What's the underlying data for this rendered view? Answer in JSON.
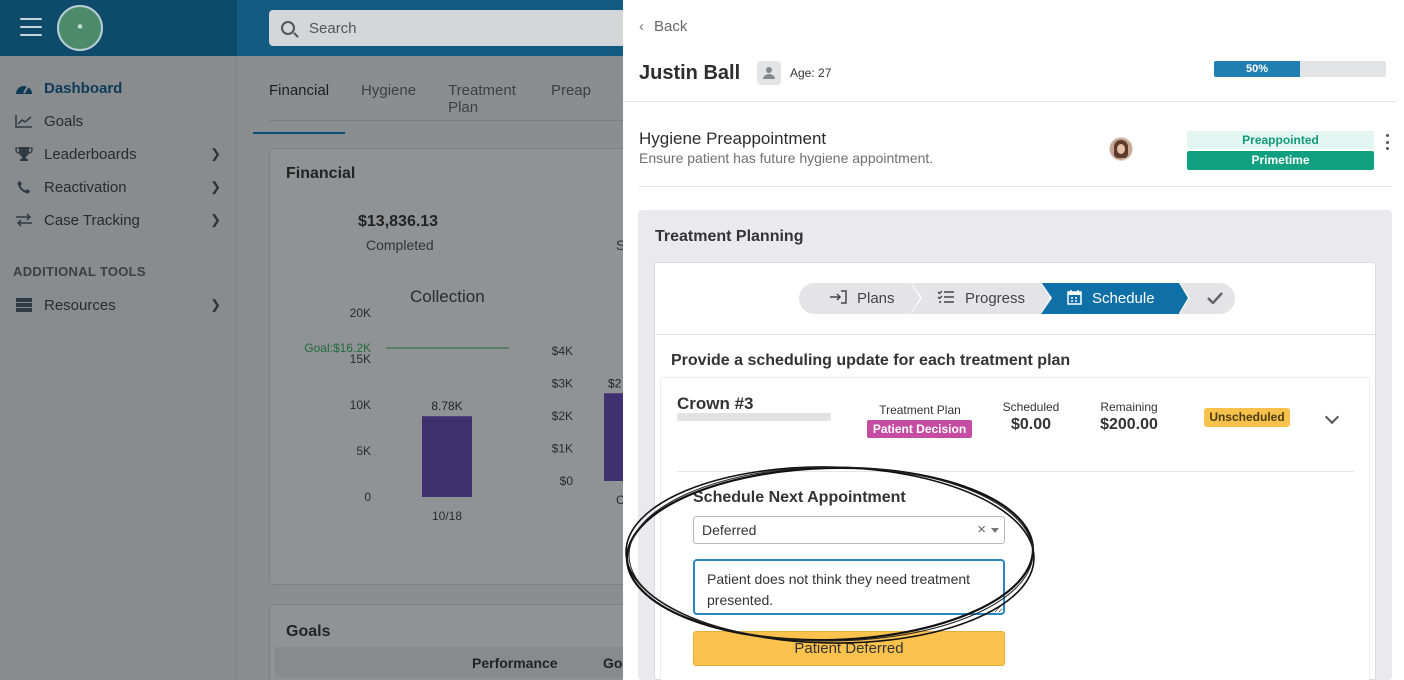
{
  "sidebar": {
    "items": [
      {
        "label": "Dashboard",
        "icon": "dashboard-gauge-icon"
      },
      {
        "label": "Goals",
        "icon": "line-chart-icon"
      },
      {
        "label": "Leaderboards",
        "icon": "trophy-icon"
      },
      {
        "label": "Reactivation",
        "icon": "phone-icon"
      },
      {
        "label": "Case Tracking",
        "icon": "arrows-exchange-icon"
      }
    ],
    "section_label": "ADDITIONAL TOOLS",
    "tools": [
      {
        "label": "Resources",
        "icon": "server-icon"
      }
    ]
  },
  "search": {
    "placeholder": "Search"
  },
  "main": {
    "tabs": [
      "Financial",
      "Hygiene",
      "Treatment Plan",
      "Preap"
    ],
    "financial": {
      "title": "Financial",
      "completed_value": "$13,836.13",
      "completed_label": "Completed",
      "partial_label": "S"
    },
    "goals": {
      "title": "Goals",
      "col_performance": "Performance",
      "col_goal": "Go"
    }
  },
  "chart_data": [
    {
      "type": "bar",
      "title": "Collection",
      "categories": [
        "10/18"
      ],
      "values": [
        8780
      ],
      "data_labels": [
        "8.78K"
      ],
      "y_ticks": [
        "0",
        "5K",
        "10K",
        "15K",
        "20K"
      ],
      "ylim": [
        0,
        20000
      ],
      "goal": 16200,
      "goal_label": "Goal:$16.2K",
      "colors": {
        "bar": "#3f3170",
        "goal": "#1f6a3a"
      }
    },
    {
      "type": "bar",
      "title": "",
      "categories": [
        "C"
      ],
      "values": [
        2700
      ],
      "data_labels": [
        "$2"
      ],
      "y_ticks": [
        "$0",
        "$1K",
        "$2K",
        "$3K",
        "$4K"
      ],
      "ylim": [
        0,
        4000
      ],
      "colors": {
        "bar": "#3f3170"
      }
    }
  ],
  "panel": {
    "back_label": "Back",
    "patient_name": "Justin Ball",
    "age_label": "Age: 27",
    "progress_label": "50%",
    "progress_value": 0.5,
    "task": {
      "title": "Hygiene Preappointment",
      "subtitle": "Ensure patient has future hygiene appointment.",
      "badge_status": "Preappointed",
      "badge_time": "Primetime"
    },
    "treatment_planning": {
      "title": "Treatment Planning",
      "steps": [
        {
          "label": "Plans",
          "icon": "sign-in-icon"
        },
        {
          "label": "Progress",
          "icon": "checklist-icon"
        },
        {
          "label": "Schedule",
          "icon": "calendar-icon"
        },
        {
          "label": "",
          "icon": "checkmark-icon"
        }
      ],
      "prompt": "Provide a scheduling update for each treatment plan",
      "plan": {
        "name": "Crown #3",
        "treatment_plan_label": "Treatment Plan",
        "treatment_plan_status": "Patient Decision",
        "scheduled_label": "Scheduled",
        "scheduled_value": "$0.00",
        "remaining_label": "Remaining",
        "remaining_value": "$200.00",
        "schedule_status": "Unscheduled"
      },
      "next_appointment": {
        "title": "Schedule Next Appointment",
        "selected": "Deferred",
        "clear_symbol": "×",
        "note": "Patient does not think they need treatment presented.",
        "button_label": "Patient Deferred"
      }
    }
  },
  "colors": {
    "accent": "#0f6fa7",
    "progress": "#1f7fb2",
    "primetime": "#12a180",
    "preappointed_bg": "#e2f7f1",
    "patient_decision": "#c54ca2",
    "unscheduled": "#f8c14c",
    "deferred_button": "#fcc24e"
  }
}
